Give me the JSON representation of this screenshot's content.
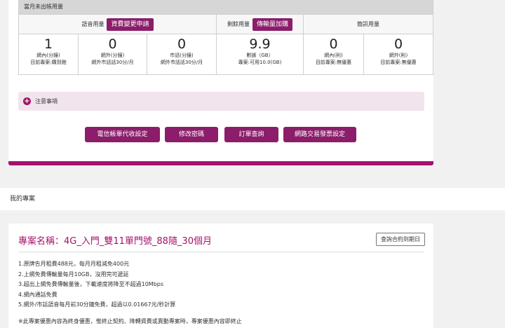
{
  "usage": {
    "header": "當月未出帳用量",
    "categories": {
      "voice": "語音用量",
      "voice_button": "資費變更申請",
      "data": "剩餘用量",
      "data_button": "傳輸量加購",
      "sms": "簡訊用量"
    },
    "values": [
      {
        "num": "1",
        "unit": "網內(分鐘)",
        "desc": "目前專案:購到飽"
      },
      {
        "num": "0",
        "unit": "網外(分鐘)",
        "desc": "網外市話話30分/月"
      },
      {
        "num": "0",
        "unit": "市話(分鐘)",
        "desc": "網外市話話30分/月"
      },
      {
        "num": "9.9",
        "unit": "數據（GB）",
        "desc": "專案:可用10.0(GB)"
      },
      {
        "num": "0",
        "unit": "網內(則)",
        "desc": "目前專案:無優惠"
      },
      {
        "num": "0",
        "unit": "網外(則)",
        "desc": "目前專案:無優惠"
      }
    ]
  },
  "notice": {
    "label": "注意事項"
  },
  "actions": [
    "電信帳單代收設定",
    "修改密碼",
    "訂單查詢",
    "網路交易發票設定"
  ],
  "section": {
    "title": "我的專案"
  },
  "plan": {
    "name": "專案名稱：4G_入門_雙11單門號_88隨_30個月",
    "contract_button": "查詢合約到期日",
    "items": [
      "1.原牌告月租費488元，每月月租減免400元",
      "2.上網免費傳輸量每月10GB，沒用完可遞延",
      "3.超出上網免費傳輸量後，下載速度將降至不超過10Mbps",
      "4.網內通話免費",
      "5.網外/市話語音每月前30分鐘免費，超過以0.01667元/秒計算"
    ],
    "note": "※此專案優惠內容為終身優惠，惟終止契約、降轉資費或異動專案時，專案優惠內容即終止"
  },
  "colors": {
    "accent": "#a4126b",
    "button": "#8b1d6a"
  }
}
